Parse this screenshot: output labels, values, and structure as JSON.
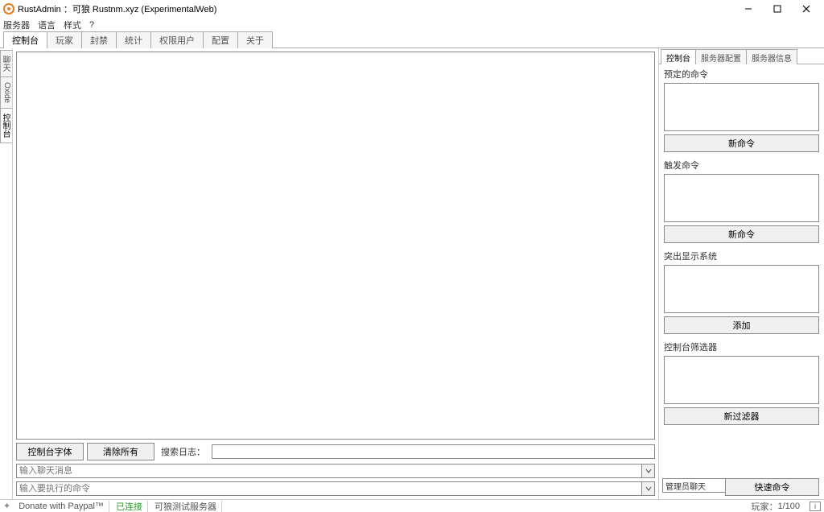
{
  "window": {
    "title": "RustAdmin ：可狼 Rustnm.xyz (ExperimentalWeb)"
  },
  "menu": {
    "server": "服务器",
    "language": "语言",
    "style": "样式",
    "help": "?"
  },
  "top_tabs": {
    "console": "控制台",
    "players": "玩家",
    "bans": "封禁",
    "stats": "统计",
    "privileged": "权限用户",
    "config": "配置",
    "about": "关于"
  },
  "vertical_tabs": {
    "chat": "聊天",
    "oxide": "Oxide",
    "console": "控制台"
  },
  "console_toolbar": {
    "font": "控制台字体",
    "clear": "清除所有",
    "search_label": "搜索日志："
  },
  "chat": {
    "chat_placeholder": "输入聊天消息",
    "cmd_placeholder": "输入要执行的命令"
  },
  "right_tabs": {
    "console": "控制台",
    "server_config": "服务器配置",
    "server_info": "服务器信息"
  },
  "panels": {
    "scheduled": {
      "label": "预定的命令",
      "button": "新命令"
    },
    "trigger": {
      "label": "触发命令",
      "button": "新命令"
    },
    "popup": {
      "label": "突出显示系统",
      "button": "添加"
    },
    "filter": {
      "label": "控制台筛选器",
      "button": "新过滤器"
    }
  },
  "quick": {
    "type": "管理员聊天",
    "button": "快速命令"
  },
  "status": {
    "donate": "Donate with Paypal™",
    "connected": "已连接",
    "server": "可狼测试服务器",
    "players_label": "玩家：",
    "players_value": "1/100",
    "info": "i"
  }
}
